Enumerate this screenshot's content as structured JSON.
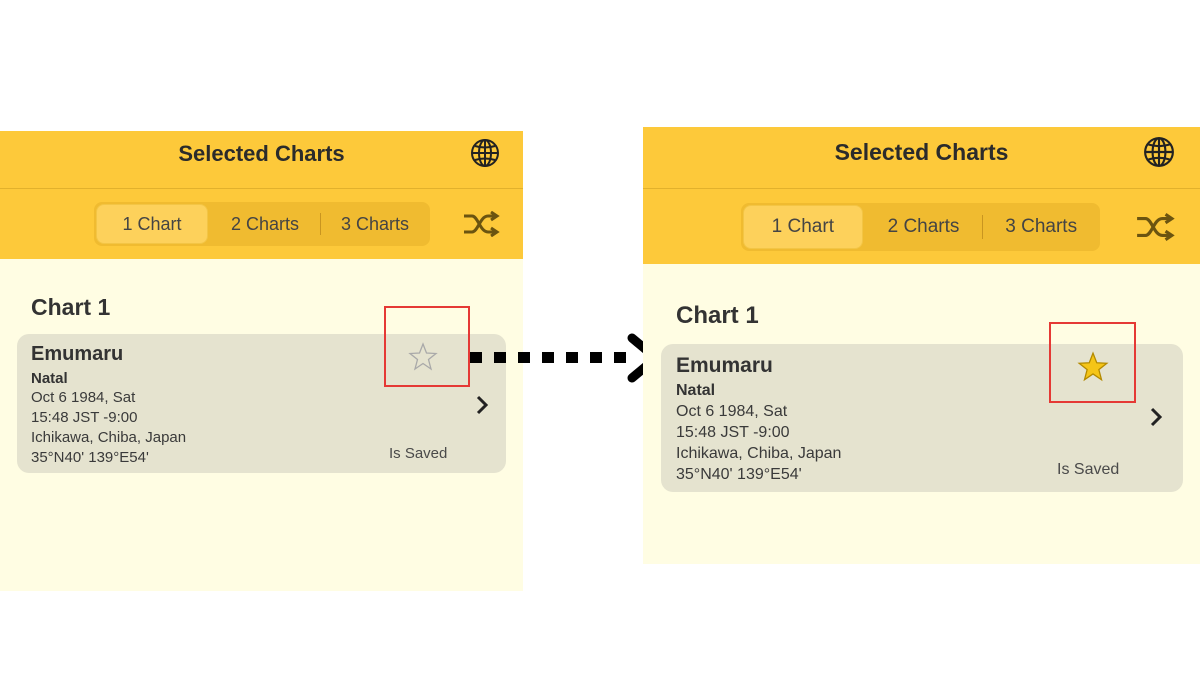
{
  "screens": [
    {
      "title": "Selected Charts",
      "tabs": [
        "1 Chart",
        "2 Charts",
        "3 Charts"
      ],
      "active_tab": "1 Chart",
      "section_title": "Chart 1",
      "card": {
        "name": "Emumaru",
        "type": "Natal",
        "date": "Oct 6 1984, Sat",
        "time": "15:48 JST -9:00",
        "place": "Ichikawa, Chiba, Japan",
        "coords": "35°N40' 139°E54'",
        "status": "Is Saved",
        "favorite": false
      }
    },
    {
      "title": "Selected Charts",
      "tabs": [
        "1 Chart",
        "2 Charts",
        "3 Charts"
      ],
      "active_tab": "1 Chart",
      "section_title": "Chart 1",
      "card": {
        "name": "Emumaru",
        "type": "Natal",
        "date": "Oct 6 1984, Sat",
        "time": "15:48 JST -9:00",
        "place": "Ichikawa, Chiba, Japan",
        "coords": "35°N40' 139°E54'",
        "status": "Is Saved",
        "favorite": true
      }
    }
  ],
  "icons": {
    "globe": "globe-icon",
    "shuffle": "shuffle-icon",
    "star_empty": "star-outline-icon",
    "star_filled": "star-filled-icon",
    "chevron": "chevron-right-icon",
    "transition_arrow": "dotted-arrow-right-icon"
  },
  "colors": {
    "header_yellow": "#fdc93a",
    "panel_cream": "#fffde3",
    "card_gray": "#e5e3cf",
    "star_gold": "#f5c518",
    "highlight_red": "#e53935"
  }
}
